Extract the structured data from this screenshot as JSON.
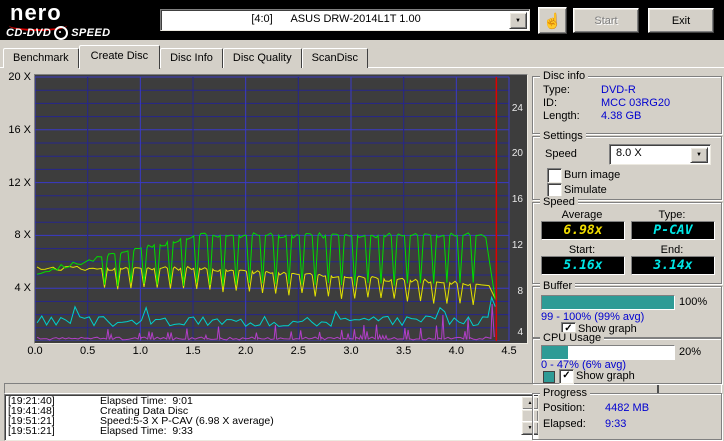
{
  "toolbar": {
    "brand": {
      "name": "nero",
      "line": "CD-DVD",
      "line2": "SPEED"
    },
    "drive_select": "[4:0]      ASUS DRW-2014L1T 1.00",
    "start": "Start",
    "exit": "Exit"
  },
  "tabs": {
    "active": 1,
    "items": [
      "Benchmark",
      "Create Disc",
      "Disc Info",
      "Disc Quality",
      "ScanDisc"
    ]
  },
  "chart_data": {
    "type": "line",
    "title": "Create Disc speed graph",
    "x_axis": {
      "unit": "GB",
      "min": 0,
      "max": 4.5,
      "ticks": [
        "0.0",
        "0.5",
        "1.0",
        "1.5",
        "2.0",
        "2.5",
        "3.0",
        "3.5",
        "4.0",
        "4.5"
      ]
    },
    "left_axis": {
      "unit": "X",
      "min": 0,
      "max": 20,
      "ticks": [
        "20 X",
        "16 X",
        "12 X",
        "8 X",
        "4 X"
      ],
      "tick_values": [
        20,
        16,
        12,
        8,
        4
      ]
    },
    "right_axis": {
      "ticks": [
        "24",
        "20",
        "16",
        "12",
        "8",
        "4"
      ],
      "tick_fractions": [
        0.12,
        0.29,
        0.465,
        0.64,
        0.815,
        0.97
      ]
    },
    "grid": {
      "minor_color": "#26268C",
      "major_color": "#3A3AC8",
      "x_step": 0.5,
      "y_step": 1
    },
    "background": "#3D3D3D",
    "dips": {
      "start": 0.66,
      "interval": 0.125,
      "until": 4.22,
      "half_width": 0.028
    },
    "series": [
      {
        "name": "buffer-graph",
        "kind": "spikes",
        "color": "#B23FC8",
        "base": 0.15,
        "spike_chance": 0.16,
        "spike_chance_right": 0.3,
        "right_from": 2.6,
        "spike_min": 0.4,
        "spike_max": 1.25,
        "spike_max_tail": 2.1,
        "tail_from": 3.85,
        "end_spike_x": 4.34,
        "end_spike_v": 2.8
      },
      {
        "name": "cpu-graph",
        "kind": "noisy",
        "color": "#00CFCF",
        "base": 1.5,
        "noise": 0.8,
        "tail": [
          [
            4.3,
            1.8
          ],
          [
            4.335,
            3.3
          ],
          [
            4.37,
            2.6
          ]
        ]
      },
      {
        "name": "rotation-speed",
        "kind": "rpm",
        "color": "#E2E200",
        "flat_value": 5.5,
        "flat_until": 1.55,
        "end_x": 4.27,
        "end_value": 4.25,
        "dip_depth": 1.55,
        "noise": 0.16,
        "tail": [
          [
            4.31,
            4.2
          ],
          [
            4.37,
            3.2
          ]
        ]
      },
      {
        "name": "write-speed",
        "kind": "pcav",
        "color": "#00DC00",
        "start": 5.16,
        "knee_x": 1.55,
        "max": 8,
        "dip_bottom": 4.3,
        "noise": 0.2,
        "tail": [
          [
            4.28,
            7.85
          ],
          [
            4.33,
            5.2
          ],
          [
            4.37,
            3.14
          ]
        ]
      }
    ],
    "end_marker": {
      "x": 4.38,
      "color": "#E00000"
    },
    "summary": {
      "type": "P-CAV",
      "average": "6.98x",
      "start": "5.16x",
      "end": "3.14x"
    }
  },
  "panels": {
    "disc_info": {
      "title": "Disc info",
      "rows": [
        [
          "Type:",
          "DVD-R"
        ],
        [
          "ID:",
          "MCC 03RG20"
        ],
        [
          "Length:",
          "4.38 GB"
        ]
      ]
    },
    "settings": {
      "title": "Settings",
      "speed_label": "Speed",
      "speed_value": "8.0 X",
      "burn_image": {
        "label": "Burn image",
        "checked": false
      },
      "simulate": {
        "label": "Simulate",
        "checked": false
      }
    },
    "speed": {
      "title": "Speed",
      "cells": [
        [
          "Average",
          "6.98x"
        ],
        [
          "Type:",
          "P-CAV"
        ],
        [
          "Start:",
          "5.16x"
        ],
        [
          "End:",
          "3.14x"
        ]
      ]
    },
    "buffer": {
      "title": "Buffer",
      "percent": "100%",
      "fill": 100,
      "range": "99 - 100% (99% avg)",
      "show_graph": {
        "label": "Show graph",
        "checked": true
      }
    },
    "cpu": {
      "title": "CPU Usage",
      "percent": "20%",
      "fill": 20,
      "range": "0 - 47% (6% avg)",
      "graph_color": "#2E9B96",
      "show_graph": {
        "label": "Show graph",
        "checked": true
      }
    },
    "progress": {
      "title": "Progress",
      "bar_marker_pct": 91,
      "rows": [
        [
          "Position:",
          "4482 MB"
        ],
        [
          "Elapsed:",
          "9:33"
        ]
      ]
    }
  },
  "log": {
    "entries": [
      [
        "[19:21:40]",
        "Elapsed Time:  9:01"
      ],
      [
        "[19:41:48]",
        "Creating Data Disc"
      ],
      [
        "[19:51:21]",
        "Speed:5-3 X P-CAV (6.98 X average)"
      ],
      [
        "[19:51:21]",
        "Elapsed Time:  9:33"
      ]
    ]
  }
}
